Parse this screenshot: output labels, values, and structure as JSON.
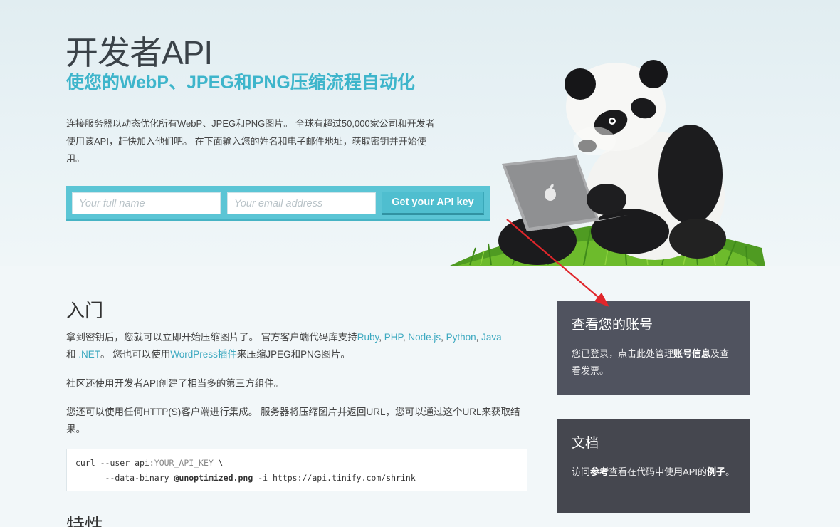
{
  "hero": {
    "title": "开发者API",
    "subtitle": "使您的WebP、JPEG和PNG压缩流程自动化",
    "intro": "连接服务器以动态优化所有WebP、JPEG和PNG图片。 全球有超过50,000家公司和开发者使用该API，赶快加入他们吧。 在下面输入您的姓名和电子邮件地址，获取密钥并开始使用。",
    "name_placeholder": "Your full name",
    "email_placeholder": "Your email address",
    "button_label": "Get your API key"
  },
  "getting_started": {
    "heading": "入门",
    "p1_a": "拿到密钥后，您就可以立即开始压缩图片了。 官方客户端代码库支持",
    "links": [
      "Ruby",
      "PHP",
      "Node.js",
      "Python",
      "Java",
      ".NET"
    ],
    "sep": ", ",
    "and": "和 ",
    "p1_b": "。 您也可以使用",
    "wp_link": "WordPress插件",
    "p1_c": "来压缩JPEG和PNG图片。",
    "p2": "社区还使用开发者API创建了相当多的第三方组件。",
    "p3": "您还可以使用任何HTTP(S)客户端进行集成。 服务器将压缩图片并返回URL，您可以通过这个URL来获取结果。",
    "code": {
      "l1_a": "curl --user api:",
      "l1_ph": "YOUR_API_KEY",
      "l1_b": " \\",
      "l2_a": "      --data-binary ",
      "l2_bold": "@unoptimized.png",
      "l2_b": " -i https://api.tinify.com/shrink"
    },
    "features_heading": "特性"
  },
  "cards": {
    "account": {
      "title": "查看您的账号",
      "text_a": "您已登录，点击此处管理",
      "text_bold": "账号信息",
      "text_b": "及查看发票。"
    },
    "docs": {
      "title": "文档",
      "text_a": "访问",
      "text_bold1": "参考",
      "text_b": "查看在代码中使用API的",
      "text_bold2": "例子",
      "text_c": "。"
    }
  },
  "colors": {
    "accent": "#3eb5cb",
    "signup_bar": "#5bc5d5",
    "card_bg": "#50535f",
    "arrow": "#e0262b"
  },
  "icons": [
    "apple-logo-icon",
    "panda-mascot",
    "red-arrow-annotation"
  ]
}
